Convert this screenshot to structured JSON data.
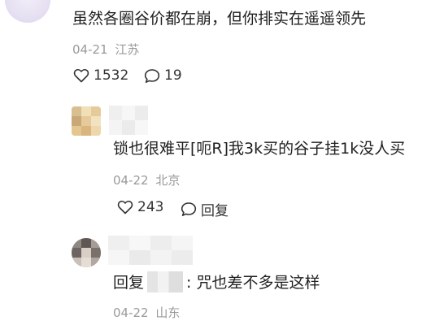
{
  "comments": [
    {
      "text": "虽然各圈谷价都在崩，但你排实在遥遥领先",
      "date": "04-21",
      "location": "江苏",
      "likes": "1532",
      "replies": "19"
    },
    {
      "text": "锁也很难平[呃R]我3k买的谷子挂1k没人买",
      "date": "04-22",
      "location": "北京",
      "likes": "243",
      "reply_label": "回复"
    },
    {
      "reply_prefix": "回复",
      "text": ": 咒也差不多是这样",
      "date": "04-22",
      "location": "山东"
    }
  ],
  "icons": {
    "like": "heart-outline-icon",
    "comment": "speech-bubble-icon"
  },
  "colors": {
    "text": "#1f1f1f",
    "meta": "#9a9a9a",
    "icon": "#333333"
  }
}
